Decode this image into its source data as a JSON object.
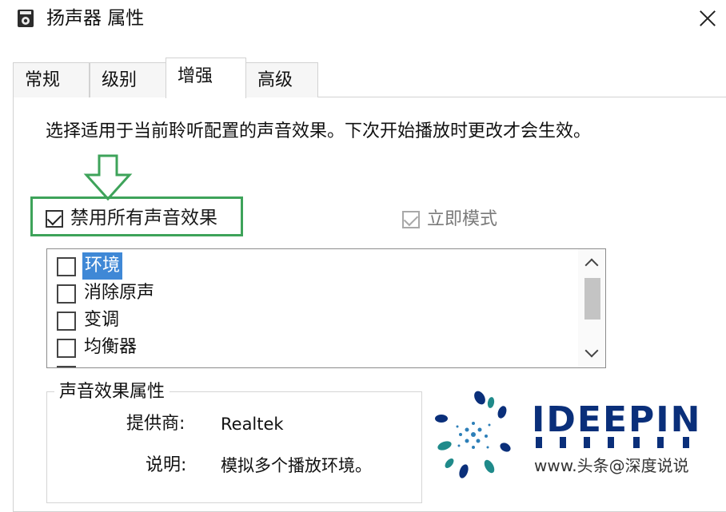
{
  "window": {
    "title": "扬声器 属性",
    "close_icon": "close-icon"
  },
  "tabs": [
    {
      "label": "常规",
      "active": false
    },
    {
      "label": "级别",
      "active": false
    },
    {
      "label": "增强",
      "active": true
    },
    {
      "label": "高级",
      "active": false
    }
  ],
  "enhancements": {
    "description": "选择适用于当前聆听配置的声音效果。下次开始播放时更改才会生效。",
    "disable_all": {
      "label": "禁用所有声音效果",
      "checked": true
    },
    "immediate_mode": {
      "label": "立即模式",
      "checked": true,
      "enabled": false
    },
    "effects": [
      {
        "label": "环境",
        "checked": false,
        "selected": true
      },
      {
        "label": "消除原声",
        "checked": false,
        "selected": false
      },
      {
        "label": "变调",
        "checked": false,
        "selected": false
      },
      {
        "label": "均衡器",
        "checked": false,
        "selected": false
      }
    ]
  },
  "properties": {
    "group_title": "声音效果属性",
    "provider_label": "提供商:",
    "provider_value": "Realtek",
    "desc_label": "说明:",
    "desc_value": "模拟多个播放环境。"
  },
  "watermark": {
    "brand": "IDEEPIN",
    "url_text": "www.头条@深度说说"
  },
  "colors": {
    "highlight_green": "#3ea35a",
    "selection_blue": "#3f88d6",
    "brand_navy": "#0a2f7a",
    "brand_teal": "#1f8a8a"
  }
}
